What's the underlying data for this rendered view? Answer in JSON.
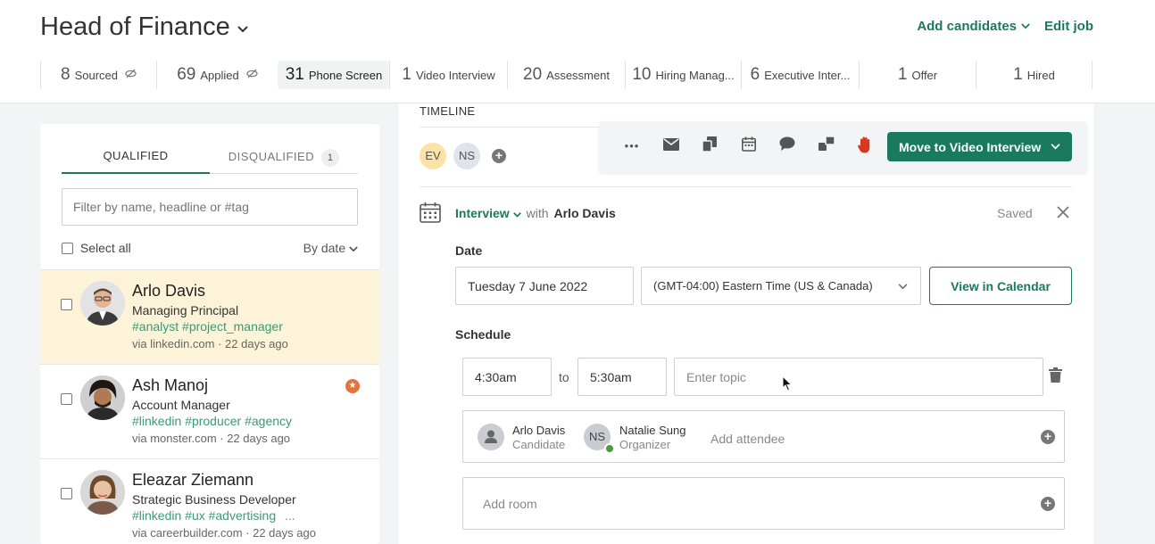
{
  "header": {
    "job_title": "Head of Finance",
    "add_candidates": "Add candidates",
    "edit_job": "Edit job"
  },
  "stages": [
    {
      "count": "8",
      "label": "Sourced",
      "hidden": true
    },
    {
      "count": "69",
      "label": "Applied",
      "hidden": true
    },
    {
      "count": "31",
      "label": "Phone Screen",
      "active": true
    },
    {
      "count": "1",
      "label": "Video Interview"
    },
    {
      "count": "20",
      "label": "Assessment"
    },
    {
      "count": "10",
      "label": "Hiring Manag..."
    },
    {
      "count": "6",
      "label": "Executive Inter..."
    },
    {
      "count": "1",
      "label": "Offer"
    },
    {
      "count": "1",
      "label": "Hired"
    }
  ],
  "left": {
    "tab_qualified": "QUALIFIED",
    "tab_disqualified": "DISQUALIFIED",
    "disqualified_count": "1",
    "filter_placeholder": "Filter by name, headline or #tag",
    "select_all": "Select all",
    "sort": "By date",
    "candidates": [
      {
        "name": "Arlo Davis",
        "role": "Managing Principal",
        "tags": "#analyst #project_manager",
        "via": "via linkedin.com · 22 days ago"
      },
      {
        "name": "Ash Manoj",
        "role": "Account Manager",
        "tags": "#linkedin #producer #agency",
        "via": "via monster.com · 22 days ago"
      },
      {
        "name": "Eleazar Ziemann",
        "role": "Strategic Business Developer",
        "tags": "#linkedin #ux #advertising",
        "tags_more": "...",
        "via": "via careerbuilder.com · 22 days ago"
      }
    ]
  },
  "right": {
    "timeline_tab": "TIMELINE",
    "followers": [
      "EV",
      "NS"
    ],
    "toolbar": {
      "more_icon": "•••",
      "move_button": "Move to Video Interview"
    },
    "interview": {
      "type": "Interview",
      "with": "with",
      "candidate": "Arlo Davis",
      "status": "Saved",
      "date_label": "Date",
      "date_value": "Tuesday 7 June 2022",
      "timezone": "(GMT-04:00) Eastern Time (US & Canada)",
      "view_calendar": "View in Calendar",
      "schedule_label": "Schedule",
      "start_time": "4:30am",
      "to": "to",
      "end_time": "5:30am",
      "topic_placeholder": "Enter topic",
      "attendees": [
        {
          "name": "Arlo Davis",
          "role": "Candidate"
        },
        {
          "initials": "NS",
          "name": "Natalie Sung",
          "role": "Organizer"
        }
      ],
      "add_attendee": "Add attendee",
      "add_room": "Add room"
    }
  },
  "colors": {
    "brand_green": "#1a7a5e",
    "selected_row": "#fdf3d9",
    "tag_green": "#3a9a78"
  }
}
